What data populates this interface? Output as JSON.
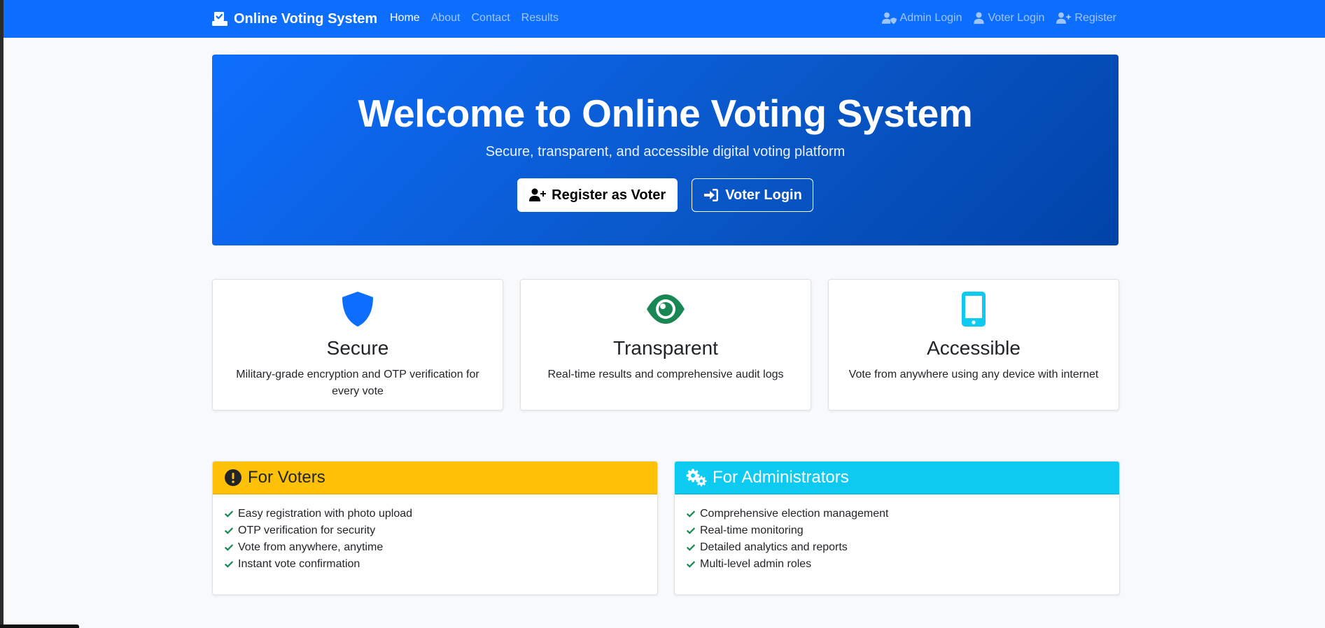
{
  "nav": {
    "brand": "Online Voting System",
    "links": [
      "Home",
      "About",
      "Contact",
      "Results"
    ],
    "right": {
      "admin_login": "Admin Login",
      "voter_login": "Voter Login",
      "register": "Register"
    }
  },
  "hero": {
    "title": "Welcome to Online Voting System",
    "subtitle": "Secure, transparent, and accessible digital voting platform",
    "register_button": "Register as Voter",
    "login_button": "Voter Login"
  },
  "features": [
    {
      "title": "Secure",
      "text": "Military-grade encryption and OTP verification for every vote",
      "icon": "shield-icon",
      "color": "#0d6efd"
    },
    {
      "title": "Transparent",
      "text": "Real-time results and comprehensive audit logs",
      "icon": "eye-icon",
      "color": "#198754"
    },
    {
      "title": "Accessible",
      "text": "Vote from anywhere using any device with internet",
      "icon": "mobile-icon",
      "color": "#0dcaf0"
    }
  ],
  "voters": {
    "title": "For Voters",
    "items": [
      "Easy registration with photo upload",
      "OTP verification for security",
      "Vote from anywhere, anytime",
      "Instant vote confirmation"
    ]
  },
  "admins": {
    "title": "For Administrators",
    "items": [
      "Comprehensive election management",
      "Real-time monitoring",
      "Detailed analytics and reports",
      "Multi-level admin roles"
    ]
  },
  "colors": {
    "primary": "#0d6efd",
    "success": "#198754",
    "warning": "#ffc107",
    "info": "#0dcaf0"
  }
}
